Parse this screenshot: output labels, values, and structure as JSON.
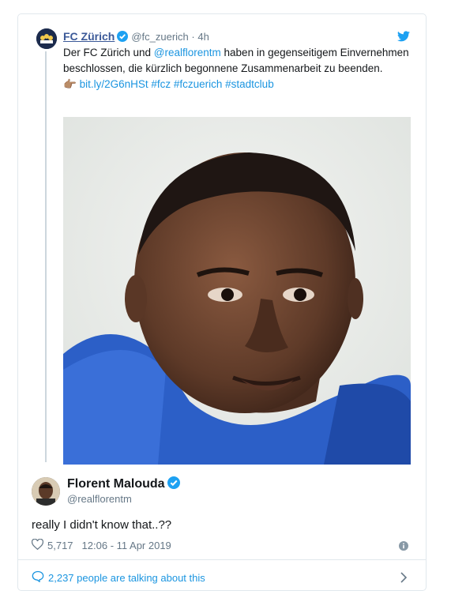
{
  "quoted": {
    "name": "FC Zürich",
    "handle": "@fc_zuerich · 4h",
    "text_before": "Der FC Zürich und ",
    "mention": "@realflorentm",
    "text_after": " haben in gegenseitigem Einvernehmen beschlossen, die kürzlich begonnene Zusammenarbeit zu beenden.",
    "pointing_emoji": "👉🏽",
    "links": "bit.ly/2G6nHSt #fcz #fczuerich #stadtclub"
  },
  "tweet": {
    "name": "Florent Malouda",
    "handle": "@realflorentm",
    "text": "really I didn't know that..??",
    "likes": "5,717",
    "timestamp": "12:06 - 11 Apr 2019"
  },
  "footer": {
    "talking": "2,237 people are talking about this"
  },
  "colors": {
    "link": "#1b95e0",
    "name_link": "#3b5998",
    "muted": "#657786",
    "border": "#e1e8ed"
  }
}
